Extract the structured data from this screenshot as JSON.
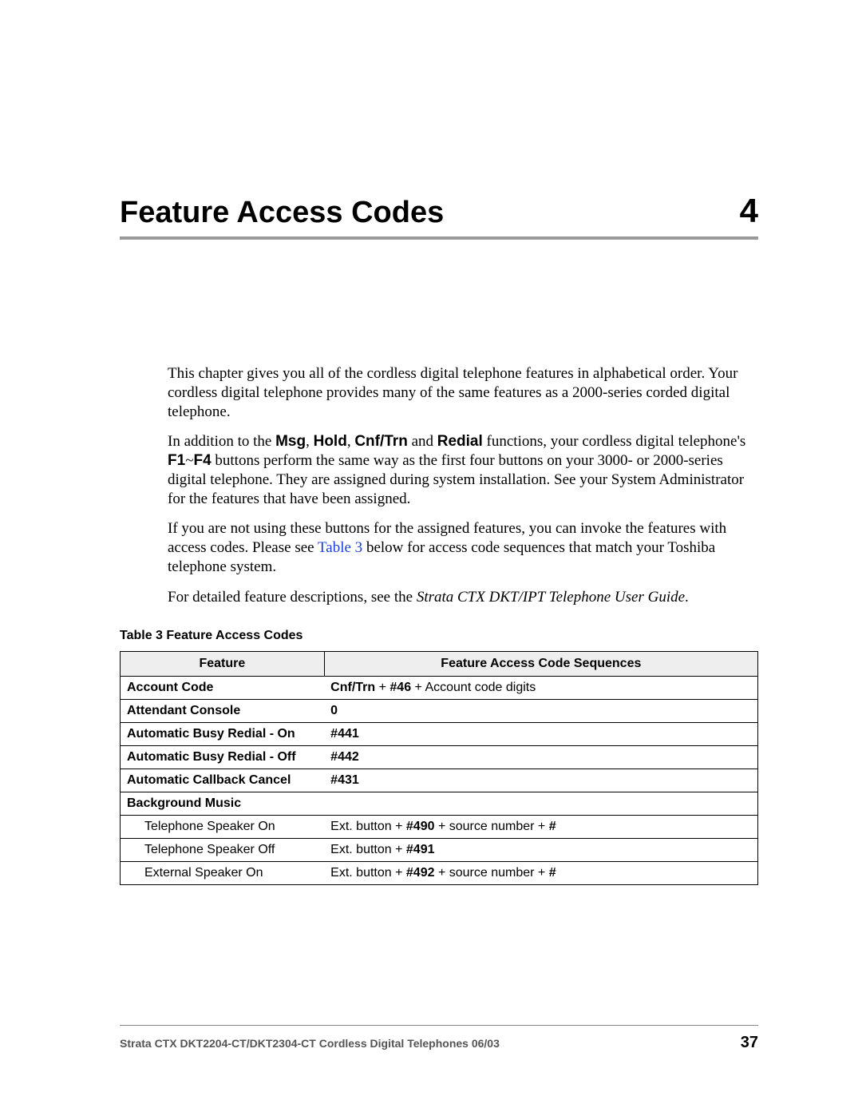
{
  "chapter": {
    "title": "Feature Access Codes",
    "number": "4"
  },
  "paragraphs": {
    "p1": "This chapter gives you all of the cordless digital telephone features in alphabetical order. Your cordless digital telephone provides many of the same features as a 2000-series corded digital telephone.",
    "p2_a": "In addition to the ",
    "p2_msg": "Msg",
    "p2_b": ", ",
    "p2_hold": "Hold",
    "p2_c": ", ",
    "p2_cnf": "Cnf/Trn",
    "p2_d": " and ",
    "p2_redial": "Redial",
    "p2_e": " functions, your cordless digital telephone's ",
    "p2_f1": "F1",
    "p2_tilde": "~",
    "p2_f4": "F4",
    "p2_f": " buttons perform the same way as the first four buttons on your 3000- or 2000-series digital telephone. They are assigned during system installation. See your System Administrator for the features that have been assigned.",
    "p3_a": "If you are not using these buttons for the assigned features, you can invoke the features with access codes. Please see ",
    "p3_link": "Table 3",
    "p3_b": " below for access code sequences that match your Toshiba telephone system.",
    "p4_a": "For detailed feature descriptions, see the ",
    "p4_i": "Strata CTX DKT/IPT Telephone User Guide",
    "p4_b": "."
  },
  "table": {
    "caption": "Table 3   Feature Access Codes",
    "headers": {
      "feature": "Feature",
      "sequence": "Feature Access Code Sequences"
    },
    "rows": {
      "r1_f": "Account Code",
      "r1_s_a": "Cnf/Trn",
      "r1_s_b": " + ",
      "r1_s_c": "#46",
      "r1_s_d": " + Account code digits",
      "r2_f": "Attendant Console",
      "r2_s": "0",
      "r3_f": "Automatic Busy Redial - On",
      "r3_s": "#441",
      "r4_f": "Automatic Busy Redial - Off",
      "r4_s": "#442",
      "r5_f": "Automatic Callback Cancel",
      "r5_s": "#431",
      "r6_f": "Background Music",
      "r6_s": "",
      "r7_f": "Telephone Speaker On",
      "r7_s_a": "Ext. button + ",
      "r7_s_b": "#490",
      "r7_s_c": " + source number + ",
      "r7_s_d": "#",
      "r8_f": "Telephone Speaker Off",
      "r8_s_a": "Ext. button + ",
      "r8_s_b": "#491",
      "r9_f": "External Speaker On",
      "r9_s_a": "Ext. button + ",
      "r9_s_b": "#492",
      "r9_s_c": " + source number + ",
      "r9_s_d": "#"
    }
  },
  "footer": {
    "text": "Strata CTX DKT2204-CT/DKT2304-CT Cordless Digital Telephones   06/03",
    "page": "37"
  }
}
